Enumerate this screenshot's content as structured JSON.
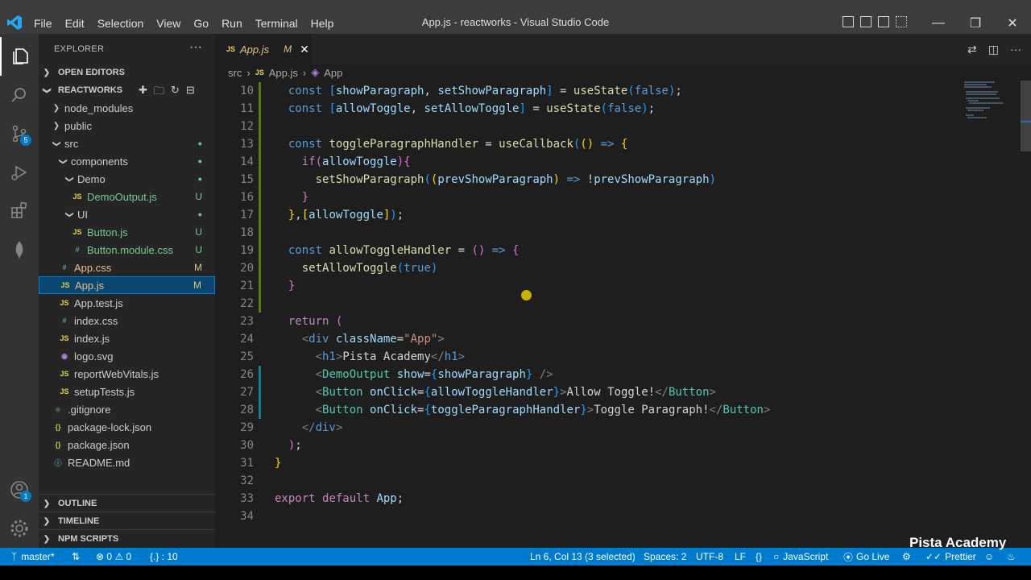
{
  "menu": [
    "File",
    "Edit",
    "Selection",
    "View",
    "Go",
    "Run",
    "Terminal",
    "Help"
  ],
  "window_title": "App.js - reactworks - Visual Studio Code",
  "activity_badges": {
    "scm": "5",
    "accounts": "1"
  },
  "explorer": {
    "title": "EXPLORER",
    "open_editors": "OPEN EDITORS",
    "project": "REACTWORKS",
    "tree": [
      {
        "label": "node_modules",
        "type": "folder-closed",
        "depth": 1,
        "status": ""
      },
      {
        "label": "public",
        "type": "folder-closed",
        "depth": 1,
        "status": ""
      },
      {
        "label": "src",
        "type": "folder-open",
        "depth": 1,
        "status": "dot"
      },
      {
        "label": "components",
        "type": "folder-open",
        "depth": 2,
        "status": "dot"
      },
      {
        "label": "Demo",
        "type": "folder-open",
        "depth": 3,
        "status": "dot"
      },
      {
        "label": "DemoOutput.js",
        "type": "js",
        "depth": 4,
        "status": "U"
      },
      {
        "label": "UI",
        "type": "folder-open",
        "depth": 3,
        "status": "dot"
      },
      {
        "label": "Button.js",
        "type": "js",
        "depth": 4,
        "status": "U"
      },
      {
        "label": "Button.module.css",
        "type": "css",
        "depth": 4,
        "status": "U"
      },
      {
        "label": "App.css",
        "type": "css",
        "depth": 2,
        "status": "M"
      },
      {
        "label": "App.js",
        "type": "js",
        "depth": 2,
        "status": "M",
        "selected": true
      },
      {
        "label": "App.test.js",
        "type": "js",
        "depth": 2,
        "status": ""
      },
      {
        "label": "index.css",
        "type": "css",
        "depth": 2,
        "status": ""
      },
      {
        "label": "index.js",
        "type": "js",
        "depth": 2,
        "status": ""
      },
      {
        "label": "logo.svg",
        "type": "svg",
        "depth": 2,
        "status": ""
      },
      {
        "label": "reportWebVitals.js",
        "type": "js",
        "depth": 2,
        "status": ""
      },
      {
        "label": "setupTests.js",
        "type": "js",
        "depth": 2,
        "status": ""
      },
      {
        "label": ".gitignore",
        "type": "git",
        "depth": 1,
        "status": ""
      },
      {
        "label": "package-lock.json",
        "type": "json",
        "depth": 1,
        "status": ""
      },
      {
        "label": "package.json",
        "type": "json",
        "depth": 1,
        "status": ""
      },
      {
        "label": "README.md",
        "type": "info",
        "depth": 1,
        "status": ""
      }
    ],
    "outline": "OUTLINE",
    "timeline": "TIMELINE",
    "npm_scripts": "NPM SCRIPTS"
  },
  "tab": {
    "icon": "JS",
    "label": "App.js",
    "status": "M"
  },
  "breadcrumb": [
    "src",
    "App.js",
    "App"
  ],
  "code": [
    {
      "n": "10",
      "tokens": [
        [
          "  ",
          ""
        ],
        [
          "const ",
          "kw"
        ],
        [
          "[",
          "br3"
        ],
        [
          "showParagraph",
          "var"
        ],
        [
          ", ",
          ""
        ],
        [
          "setShowParagraph",
          "var"
        ],
        [
          "]",
          "br3"
        ],
        [
          " = ",
          ""
        ],
        [
          "useState",
          "fn"
        ],
        [
          "(",
          "br3"
        ],
        [
          "false",
          "kw"
        ],
        [
          ")",
          "br3"
        ],
        [
          ";",
          ""
        ]
      ]
    },
    {
      "n": "11",
      "tokens": [
        [
          "  ",
          ""
        ],
        [
          "const ",
          "kw"
        ],
        [
          "[",
          "br3"
        ],
        [
          "allowToggle",
          "var"
        ],
        [
          ", ",
          ""
        ],
        [
          "setAllowToggle",
          "var"
        ],
        [
          "]",
          "br3"
        ],
        [
          " = ",
          ""
        ],
        [
          "useState",
          "fn"
        ],
        [
          "(",
          "br3"
        ],
        [
          "false",
          "kw"
        ],
        [
          ")",
          "br3"
        ],
        [
          ";",
          ""
        ]
      ]
    },
    {
      "n": "12",
      "tokens": []
    },
    {
      "n": "13",
      "tokens": [
        [
          "  ",
          ""
        ],
        [
          "const ",
          "kw"
        ],
        [
          "toggleParagraphHandler",
          "fn"
        ],
        [
          " = ",
          ""
        ],
        [
          "useCallback",
          "fn"
        ],
        [
          "(",
          "br3"
        ],
        [
          "(",
          "br"
        ],
        [
          ")",
          "br"
        ],
        [
          " => ",
          "kw"
        ],
        [
          "{",
          "br"
        ]
      ]
    },
    {
      "n": "14",
      "tokens": [
        [
          "    ",
          ""
        ],
        [
          "if",
          "ctl"
        ],
        [
          "(",
          "br2"
        ],
        [
          "allowToggle",
          "var"
        ],
        [
          ")",
          "br2"
        ],
        [
          "{",
          "br2"
        ]
      ]
    },
    {
      "n": "15",
      "tokens": [
        [
          "      ",
          ""
        ],
        [
          "setShowParagraph",
          "fn"
        ],
        [
          "(",
          "br3"
        ],
        [
          "(",
          "br"
        ],
        [
          "prevShowParagraph",
          "var"
        ],
        [
          ")",
          "br"
        ],
        [
          " => ",
          "kw"
        ],
        [
          "!",
          ""
        ],
        [
          "prevShowParagraph",
          "var"
        ],
        [
          ")",
          "br3"
        ]
      ]
    },
    {
      "n": "16",
      "tokens": [
        [
          "    ",
          ""
        ],
        [
          "}",
          "br2"
        ]
      ]
    },
    {
      "n": "17",
      "tokens": [
        [
          "  ",
          ""
        ],
        [
          "}",
          "br"
        ],
        [
          ",",
          ""
        ],
        [
          "[",
          "br"
        ],
        [
          "allowToggle",
          "var"
        ],
        [
          "]",
          "br"
        ],
        [
          ")",
          "br3"
        ],
        [
          ";",
          ""
        ]
      ]
    },
    {
      "n": "18",
      "tokens": []
    },
    {
      "n": "19",
      "tokens": [
        [
          "  ",
          ""
        ],
        [
          "const ",
          "kw"
        ],
        [
          "allowToggleHandler",
          "fn"
        ],
        [
          " = ",
          ""
        ],
        [
          "(",
          "br2"
        ],
        [
          ")",
          "br2"
        ],
        [
          " => ",
          "kw"
        ],
        [
          "{",
          "br2"
        ]
      ]
    },
    {
      "n": "20",
      "tokens": [
        [
          "    ",
          ""
        ],
        [
          "setAllowToggle",
          "fn"
        ],
        [
          "(",
          "br3"
        ],
        [
          "true",
          "kw"
        ],
        [
          ")",
          "br3"
        ]
      ]
    },
    {
      "n": "21",
      "tokens": [
        [
          "  ",
          ""
        ],
        [
          "}",
          "br2"
        ]
      ]
    },
    {
      "n": "22",
      "tokens": []
    },
    {
      "n": "23",
      "tokens": [
        [
          "  ",
          ""
        ],
        [
          "return ",
          "ctl"
        ],
        [
          "(",
          "br2"
        ]
      ]
    },
    {
      "n": "24",
      "tokens": [
        [
          "    ",
          ""
        ],
        [
          "<",
          "gt"
        ],
        [
          "div ",
          "kw"
        ],
        [
          "className",
          "var"
        ],
        [
          "=",
          ""
        ],
        [
          "\"App\"",
          "str"
        ],
        [
          ">",
          "gt"
        ]
      ]
    },
    {
      "n": "25",
      "tokens": [
        [
          "      ",
          ""
        ],
        [
          "<",
          "gt"
        ],
        [
          "h1",
          "kw"
        ],
        [
          ">",
          "gt"
        ],
        [
          "Pista Academy",
          ""
        ],
        [
          "</",
          "gt"
        ],
        [
          "h1",
          "kw"
        ],
        [
          ">",
          "gt"
        ]
      ]
    },
    {
      "n": "26",
      "tokens": [
        [
          "      ",
          ""
        ],
        [
          "<",
          "gt"
        ],
        [
          "DemoOutput ",
          "tag"
        ],
        [
          "show",
          "var"
        ],
        [
          "=",
          ""
        ],
        [
          "{",
          "br3"
        ],
        [
          "showParagraph",
          "var"
        ],
        [
          "}",
          "br3"
        ],
        [
          " />",
          "gt"
        ]
      ]
    },
    {
      "n": "27",
      "tokens": [
        [
          "      ",
          ""
        ],
        [
          "<",
          "gt"
        ],
        [
          "Button ",
          "tag"
        ],
        [
          "onClick",
          "var"
        ],
        [
          "=",
          ""
        ],
        [
          "{",
          "br3"
        ],
        [
          "allowToggleHandler",
          "var"
        ],
        [
          "}",
          "br3"
        ],
        [
          ">",
          "gt"
        ],
        [
          "Allow Toggle!",
          ""
        ],
        [
          "</",
          "gt"
        ],
        [
          "Button",
          "tag"
        ],
        [
          ">",
          "gt"
        ]
      ]
    },
    {
      "n": "28",
      "tokens": [
        [
          "      ",
          ""
        ],
        [
          "<",
          "gt"
        ],
        [
          "Button ",
          "tag"
        ],
        [
          "onClick",
          "var"
        ],
        [
          "=",
          ""
        ],
        [
          "{",
          "br3"
        ],
        [
          "toggleParagraphHandler",
          "var"
        ],
        [
          "}",
          "br3"
        ],
        [
          ">",
          "gt"
        ],
        [
          "Toggle Paragraph!",
          ""
        ],
        [
          "</",
          "gt"
        ],
        [
          "Button",
          "tag"
        ],
        [
          ">",
          "gt"
        ]
      ]
    },
    {
      "n": "29",
      "tokens": [
        [
          "    ",
          ""
        ],
        [
          "</",
          "gt"
        ],
        [
          "div",
          "kw"
        ],
        [
          ">",
          "gt"
        ]
      ]
    },
    {
      "n": "30",
      "tokens": [
        [
          "  ",
          ""
        ],
        [
          ")",
          "br2"
        ],
        [
          ";",
          ""
        ]
      ]
    },
    {
      "n": "31",
      "tokens": [
        [
          "}",
          "br"
        ]
      ]
    },
    {
      "n": "32",
      "tokens": []
    },
    {
      "n": "33",
      "tokens": [
        [
          "export ",
          "ctl"
        ],
        [
          "default ",
          "ctl"
        ],
        [
          "App",
          "var"
        ],
        [
          ";",
          ""
        ]
      ]
    },
    {
      "n": "34",
      "tokens": []
    }
  ],
  "statusbar": {
    "branch": "master*",
    "errors": "0",
    "warnings": "0",
    "selector": "{.} : 10",
    "position": "Ln 6, Col 13 (3 selected)",
    "spaces": "Spaces: 2",
    "encoding": "UTF-8",
    "eol": "LF",
    "braces": "{}",
    "language": "JavaScript",
    "golive": "Go Live",
    "prettier": "Prettier"
  },
  "watermark": "Pista Academy"
}
